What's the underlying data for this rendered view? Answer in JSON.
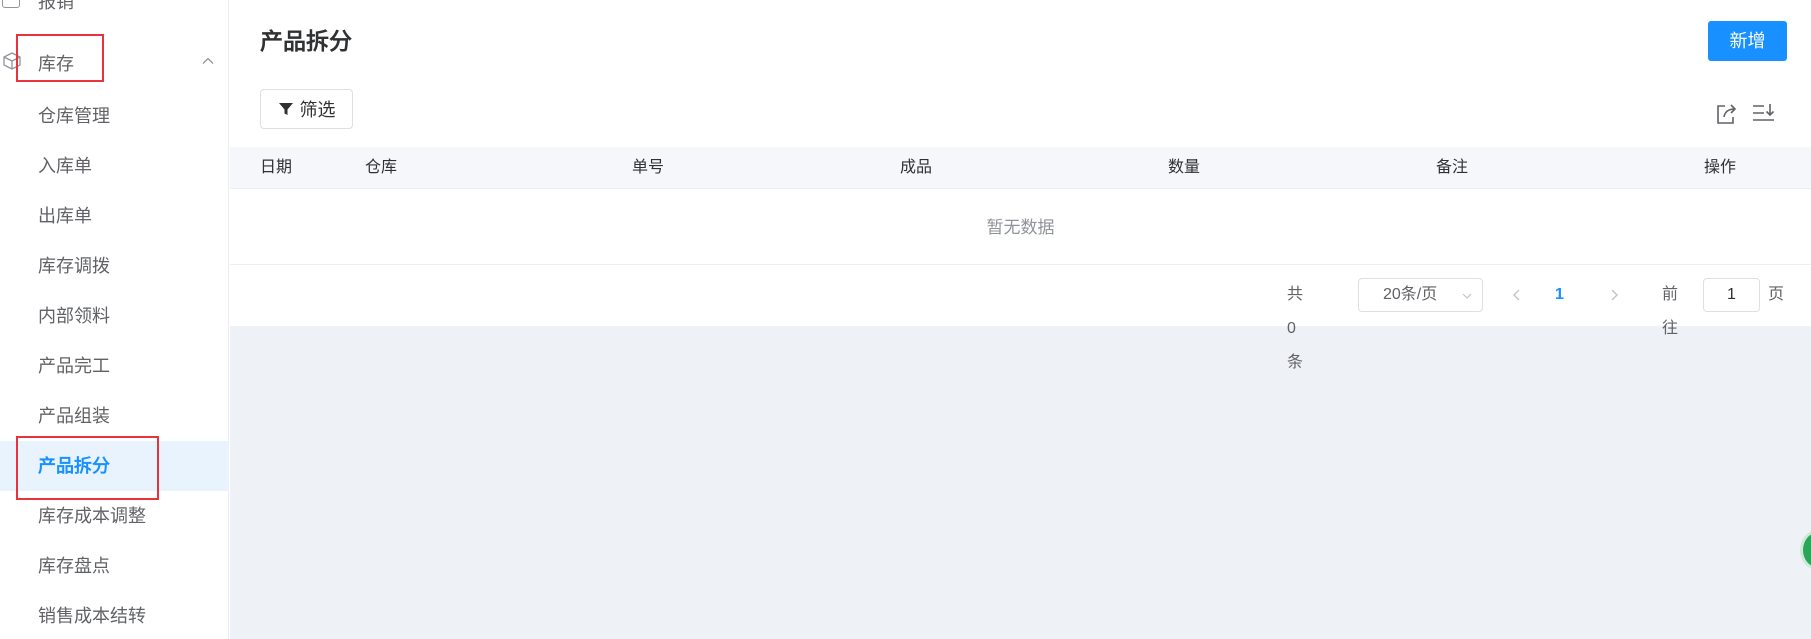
{
  "sidebar": {
    "top_fragment": "报销",
    "group_label": "库存",
    "items": [
      {
        "label": "仓库管理"
      },
      {
        "label": "入库单"
      },
      {
        "label": "出库单"
      },
      {
        "label": "库存调拨"
      },
      {
        "label": "内部领料"
      },
      {
        "label": "产品完工"
      },
      {
        "label": "产品组装"
      },
      {
        "label": "产品拆分",
        "active": true
      },
      {
        "label": "库存成本调整"
      },
      {
        "label": "库存盘点"
      },
      {
        "label": "销售成本结转"
      }
    ]
  },
  "main": {
    "title": "产品拆分",
    "add_button": "新增",
    "filter_button": "筛选",
    "columns": [
      "日期",
      "仓库",
      "单号",
      "成品",
      "数量",
      "备注",
      "操作"
    ],
    "empty_text": "暂无数据",
    "pagination": {
      "total_text": "共 0 条",
      "page_size": "20条/页",
      "current_page": "1",
      "goto_label": "前往",
      "goto_value": "1",
      "goto_unit": "页"
    }
  },
  "colors": {
    "accent": "#1890ff",
    "highlight": "#e8323c",
    "active_bg": "#e8f3fe"
  }
}
